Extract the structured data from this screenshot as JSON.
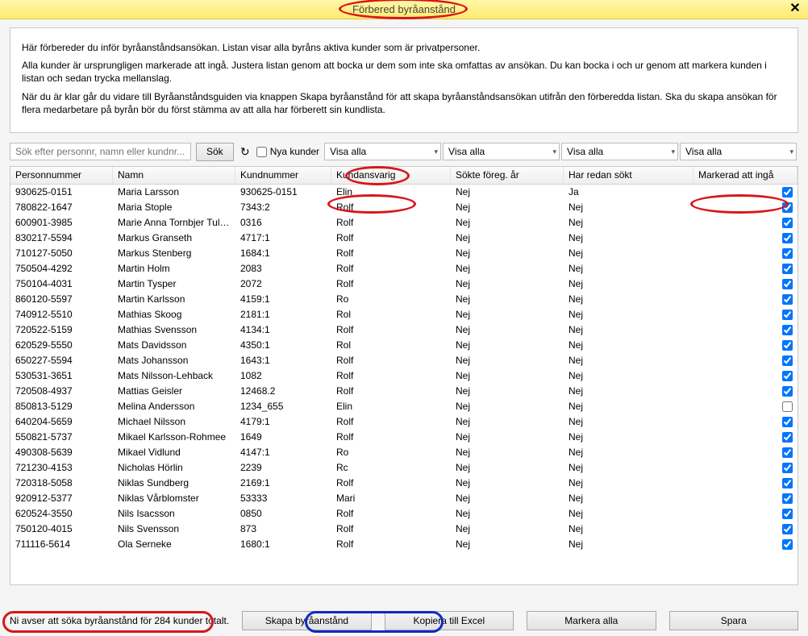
{
  "window": {
    "title": "Förbered byråanstånd",
    "close_label": "✕"
  },
  "intro": {
    "p1": "Här förbereder du inför byråanståndsansökan. Listan visar alla byråns aktiva kunder som är privatpersoner.",
    "p2": "Alla kunder är ursprungligen markerade att ingå. Justera listan genom att bocka ur dem som inte ska omfattas av ansökan. Du kan bocka i och ur genom att markera kunden i listan och sedan trycka mellanslag.",
    "p3": "När du är klar går du vidare till Byråanståndsguiden via knappen Skapa byråanstånd för att skapa byråanståndsansökan utifrån den förberedda listan. Ska du skapa ansökan för flera medarbetare på byrån bör du först stämma av att alla har förberett sin kundlista."
  },
  "toolbar": {
    "search_placeholder": "Sök efter personnr, namn eller kundnr...",
    "search_button": "Sök",
    "new_customers_label": "Nya kunder",
    "filters": [
      "Visa alla",
      "Visa alla",
      "Visa alla",
      "Visa alla"
    ]
  },
  "columns": {
    "personnummer": "Personnummer",
    "namn": "Namn",
    "kundnummer": "Kundnummer",
    "kundansvarig": "Kundansvarig",
    "sokte": "Sökte föreg. år",
    "har_redan": "Har redan sökt",
    "markerad": "Markerad att ingå"
  },
  "rows": [
    {
      "pn": "930625-0151",
      "namn": "Maria Larsson",
      "knr": "930625-0151",
      "kansv": "Elin",
      "sokte": "Nej",
      "har": "Ja",
      "mark": true
    },
    {
      "pn": "780822-1647",
      "namn": "Maria Stople",
      "knr": "7343:2",
      "kansv": "Rolf",
      "sokte": "Nej",
      "har": "Nej",
      "mark": true
    },
    {
      "pn": "600901-3985",
      "namn": "Marie Anna Tornbjer Tullbe",
      "knr": "0316",
      "kansv": "Rolf",
      "sokte": "Nej",
      "har": "Nej",
      "mark": true
    },
    {
      "pn": "830217-5594",
      "namn": "Markus Granseth",
      "knr": "4717:1",
      "kansv": "Rolf",
      "sokte": "Nej",
      "har": "Nej",
      "mark": true
    },
    {
      "pn": "710127-5050",
      "namn": "Markus Stenberg",
      "knr": "1684:1",
      "kansv": "Rolf",
      "sokte": "Nej",
      "har": "Nej",
      "mark": true
    },
    {
      "pn": "750504-4292",
      "namn": "Martin  Holm",
      "knr": "2083",
      "kansv": "Rolf",
      "sokte": "Nej",
      "har": "Nej",
      "mark": true
    },
    {
      "pn": "750104-4031",
      "namn": "Martin  Tysper",
      "knr": "2072",
      "kansv": "Rolf",
      "sokte": "Nej",
      "har": "Nej",
      "mark": true
    },
    {
      "pn": "860120-5597",
      "namn": "Martin Karlsson",
      "knr": "4159:1",
      "kansv": "Ro",
      "sokte": "Nej",
      "har": "Nej",
      "mark": true
    },
    {
      "pn": "740912-5510",
      "namn": "Mathias Skoog",
      "knr": "2181:1",
      "kansv": "Rol",
      "sokte": "Nej",
      "har": "Nej",
      "mark": true
    },
    {
      "pn": "720522-5159",
      "namn": "Mathias Svensson",
      "knr": "4134:1",
      "kansv": "Rolf",
      "sokte": "Nej",
      "har": "Nej",
      "mark": true
    },
    {
      "pn": "620529-5550",
      "namn": "Mats Davidsson",
      "knr": "4350:1",
      "kansv": "Rol",
      "sokte": "Nej",
      "har": "Nej",
      "mark": true
    },
    {
      "pn": "650227-5594",
      "namn": "Mats Johansson",
      "knr": "1643:1",
      "kansv": "Rolf",
      "sokte": "Nej",
      "har": "Nej",
      "mark": true
    },
    {
      "pn": "530531-3651",
      "namn": "Mats Nilsson-Lehback",
      "knr": "1082",
      "kansv": "Rolf",
      "sokte": "Nej",
      "har": "Nej",
      "mark": true
    },
    {
      "pn": "720508-4937",
      "namn": "Mattias Geisler",
      "knr": "12468.2",
      "kansv": "Rolf",
      "sokte": "Nej",
      "har": "Nej",
      "mark": true
    },
    {
      "pn": "850813-5129",
      "namn": "Melina Andersson",
      "knr": "1234_655",
      "kansv": "Elin",
      "sokte": "Nej",
      "har": "Nej",
      "mark": false
    },
    {
      "pn": "640204-5659",
      "namn": "Michael Nilsson",
      "knr": "4179:1",
      "kansv": "Rolf",
      "sokte": "Nej",
      "har": "Nej",
      "mark": true
    },
    {
      "pn": "550821-5737",
      "namn": "Mikael Karlsson-Rohmee",
      "knr": "1649",
      "kansv": "Rolf",
      "sokte": "Nej",
      "har": "Nej",
      "mark": true
    },
    {
      "pn": "490308-5639",
      "namn": "Mikael Vidlund",
      "knr": "4147:1",
      "kansv": "Ro",
      "sokte": "Nej",
      "har": "Nej",
      "mark": true
    },
    {
      "pn": "721230-4153",
      "namn": "Nicholas Hörlin",
      "knr": "2239",
      "kansv": "Rc",
      "sokte": "Nej",
      "har": "Nej",
      "mark": true
    },
    {
      "pn": "720318-5058",
      "namn": "Niklas Sundberg",
      "knr": "2169:1",
      "kansv": "Rolf",
      "sokte": "Nej",
      "har": "Nej",
      "mark": true
    },
    {
      "pn": "920912-5377",
      "namn": "Niklas Vårblomster",
      "knr": "53333",
      "kansv": "Mari",
      "sokte": "Nej",
      "har": "Nej",
      "mark": true
    },
    {
      "pn": "620524-3550",
      "namn": "Nils Isacsson",
      "knr": "0850",
      "kansv": "Rolf",
      "sokte": "Nej",
      "har": "Nej",
      "mark": true
    },
    {
      "pn": "750120-4015",
      "namn": "Nils Svensson",
      "knr": "873",
      "kansv": "Rolf",
      "sokte": "Nej",
      "har": "Nej",
      "mark": true
    },
    {
      "pn": "711116-5614",
      "namn": "Ola Serneke",
      "knr": "1680:1",
      "kansv": "Rolf",
      "sokte": "Nej",
      "har": "Nej",
      "mark": true
    }
  ],
  "footer": {
    "status": "Ni avser att söka byråanstånd för 284 kunder totalt.",
    "create": "Skapa byråanstånd",
    "copy": "Kopiera till Excel",
    "select_all": "Markera alla",
    "save": "Spara"
  }
}
